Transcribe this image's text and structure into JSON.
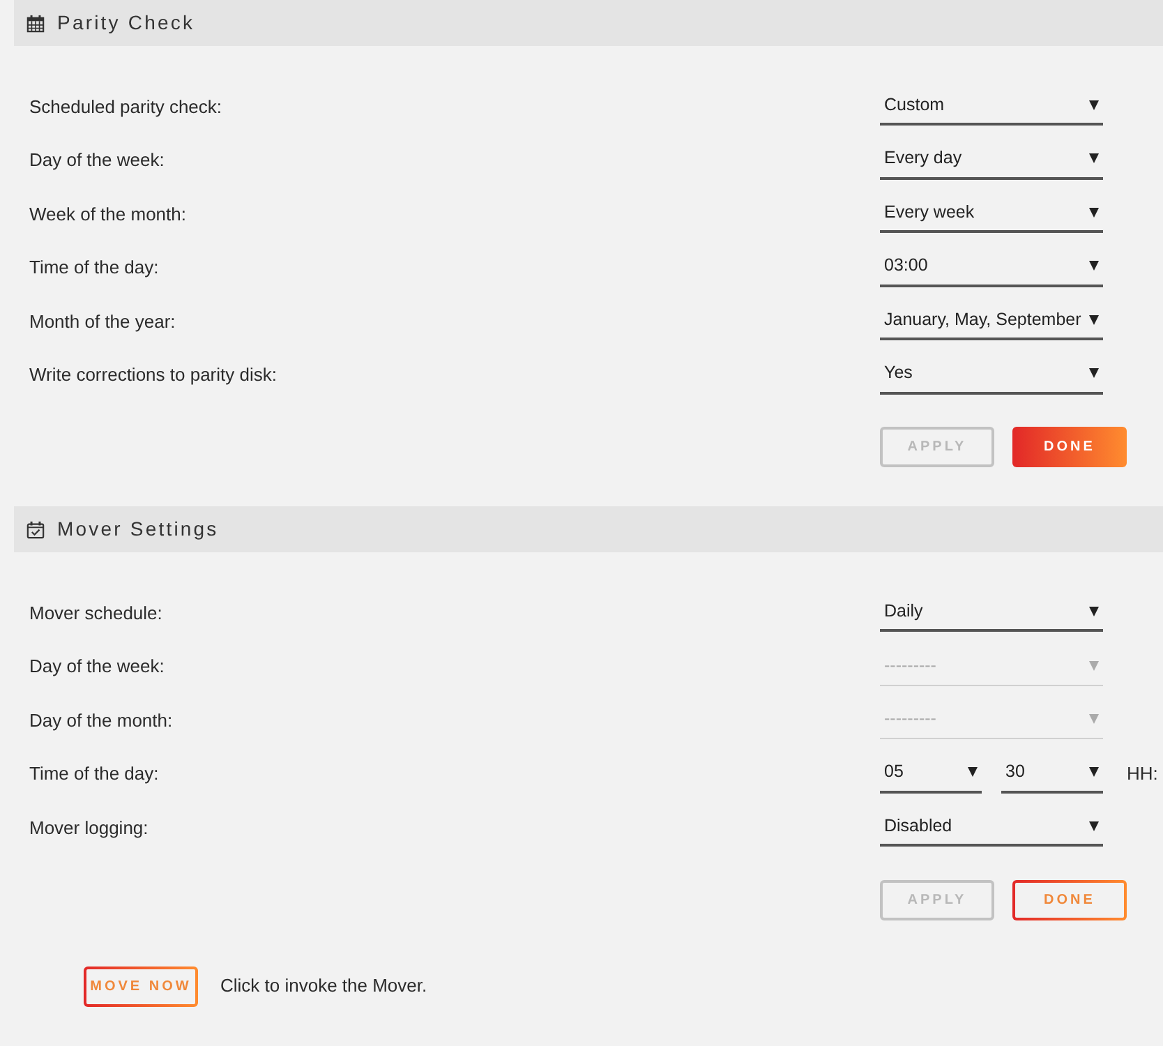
{
  "sections": [
    {
      "title": "Parity Check",
      "rows": [
        {
          "label": "Scheduled parity check:",
          "selects": [
            {
              "value": "Custom",
              "disabled": false
            }
          ]
        },
        {
          "label": "Day of the week:",
          "selects": [
            {
              "value": "Every day",
              "disabled": false
            }
          ]
        },
        {
          "label": "Week of the month:",
          "selects": [
            {
              "value": "Every week",
              "disabled": false
            }
          ]
        },
        {
          "label": "Time of the day:",
          "selects": [
            {
              "value": "03:00",
              "disabled": false
            }
          ]
        },
        {
          "label": "Month of the year:",
          "selects": [
            {
              "value": "January, May, September",
              "disabled": false
            }
          ]
        },
        {
          "label": "Write corrections to parity disk:",
          "selects": [
            {
              "value": "Yes",
              "disabled": false
            }
          ]
        }
      ],
      "buttons": [
        {
          "label": "APPLY",
          "kind": "outline",
          "disabled": true
        },
        {
          "label": "DONE",
          "kind": "filled",
          "disabled": false
        }
      ]
    },
    {
      "title": "Mover Settings",
      "rows": [
        {
          "label": "Mover schedule:",
          "selects": [
            {
              "value": "Daily",
              "disabled": false
            }
          ]
        },
        {
          "label": "Day of the week:",
          "selects": [
            {
              "value": "---------",
              "disabled": true
            }
          ]
        },
        {
          "label": "Day of the month:",
          "selects": [
            {
              "value": "---------",
              "disabled": true
            }
          ]
        },
        {
          "label": "Time of the day:",
          "selects": [
            {
              "value": "05",
              "disabled": false
            },
            {
              "value": "30",
              "disabled": false
            }
          ],
          "suffix": "HH:"
        },
        {
          "label": "Mover logging:",
          "selects": [
            {
              "value": "Disabled",
              "disabled": false
            }
          ]
        }
      ],
      "buttons": [
        {
          "label": "APPLY",
          "kind": "outline",
          "disabled": true
        },
        {
          "label": "DONE",
          "kind": "outline",
          "disabled": false
        }
      ],
      "action": {
        "label": "MOVE NOW",
        "kind": "outline",
        "disabled": false,
        "note": "Click to invoke the Mover."
      }
    }
  ]
}
